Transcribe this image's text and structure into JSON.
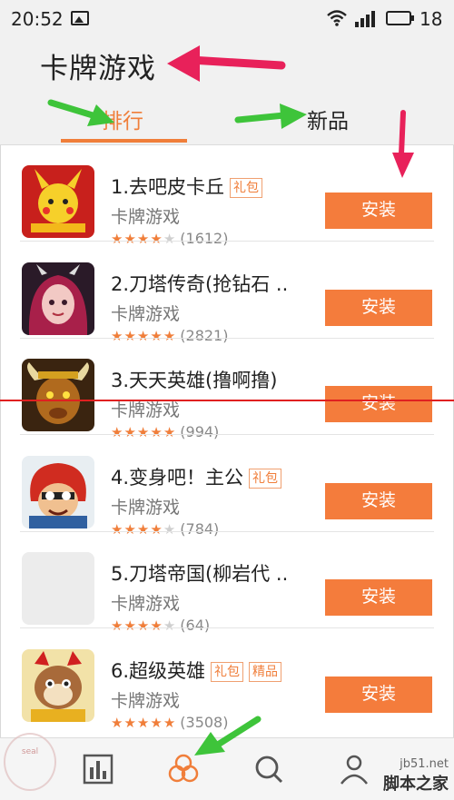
{
  "status_bar": {
    "time": "20:52",
    "battery_level": "18",
    "icons": [
      "image-icon",
      "wifi-icon",
      "signal-icon",
      "battery-icon"
    ]
  },
  "header": {
    "title": "卡牌游戏"
  },
  "tabs": [
    {
      "label": "排行",
      "active": true
    },
    {
      "label": "新品",
      "active": false
    }
  ],
  "accent_color": "#f07e3a",
  "install_button_color": "#f47c3c",
  "apps": [
    {
      "name": "1.去吧皮卡丘",
      "badges": [
        "礼包"
      ],
      "category": "卡牌游戏",
      "stars": 4,
      "count": "(1612)",
      "install_label": "安装",
      "icon": "pikachu"
    },
    {
      "name": "2.刀塔传奇(抢钻石 ..",
      "badges": [],
      "category": "卡牌游戏",
      "stars": 5,
      "count": "(2821)",
      "install_label": "安装",
      "icon": "girl"
    },
    {
      "name": "3.天天英雄(撸啊撸)",
      "badges": [],
      "category": "卡牌游戏",
      "stars": 5,
      "count": "(994)",
      "install_label": "安装",
      "icon": "bull"
    },
    {
      "name": "4.变身吧！主公",
      "badges": [
        "礼包"
      ],
      "category": "卡牌游戏",
      "stars": 4,
      "count": "(784)",
      "install_label": "安装",
      "icon": "monkey"
    },
    {
      "name": "5.刀塔帝国(柳岩代 ..",
      "badges": [],
      "category": "卡牌游戏",
      "stars": 4,
      "count": "(64)",
      "install_label": "安装",
      "icon": "blank"
    },
    {
      "name": "6.超级英雄",
      "badges": [
        "礼包",
        "精品"
      ],
      "category": "卡牌游戏",
      "stars": 5,
      "count": "(3508)",
      "install_label": "安装",
      "icon": "raccoon"
    }
  ],
  "bottom_nav": [
    "chart-icon",
    "apps-icon",
    "search-icon",
    "person-icon"
  ],
  "watermark": {
    "url": "jb51.net",
    "site": "脚本之家"
  }
}
